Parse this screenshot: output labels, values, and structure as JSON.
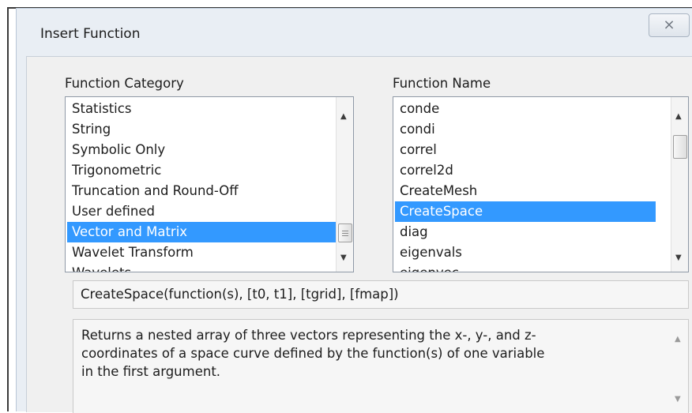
{
  "dialog": {
    "title": "Insert Function",
    "close_glyph": "⨯"
  },
  "category": {
    "label": "Function Category",
    "items": [
      "Statistics",
      "String",
      "Symbolic Only",
      "Trigonometric",
      "Truncation and Round-Off",
      "User defined",
      "Vector and Matrix",
      "Wavelet Transform",
      "Wavelets"
    ],
    "selected": "Vector and Matrix"
  },
  "function": {
    "label": "Function Name",
    "items": [
      "conde",
      "condi",
      "correl",
      "correl2d",
      "CreateMesh",
      "CreateSpace",
      "diag",
      "eigenvals",
      "eigenvec"
    ],
    "selected": "CreateSpace"
  },
  "syntax": "CreateSpace(function(s), [t0, t1], [tgrid], [fmap])",
  "description": {
    "lines": [
      "Returns a nested array of three vectors representing the x-, y-, and z-",
      "coordinates of a space curve defined by the function(s) of one variable",
      "in the first argument."
    ]
  },
  "colors": {
    "selection": "#3399ff",
    "window_bg": "#f0f0f0"
  }
}
